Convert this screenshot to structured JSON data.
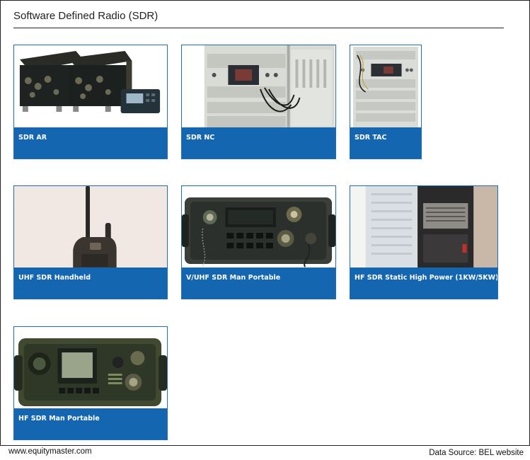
{
  "heading": "Software Defined Radio (SDR)",
  "products": [
    {
      "label": "SDR AR",
      "image": "sdr-ar-photo"
    },
    {
      "label": "SDR NC",
      "image": "sdr-nc-photo"
    },
    {
      "label": "SDR TAC",
      "image": "sdr-tac-photo"
    },
    {
      "label": "UHF SDR Handheld",
      "image": "uhf-handheld-photo"
    },
    {
      "label": "V/UHF SDR Man Portable",
      "image": "vuhf-man-portable-photo"
    },
    {
      "label": "HF SDR Static High Power (1KW/5KW)",
      "image": "hf-static-high-power-photo"
    },
    {
      "label": "HF SDR Man Portable",
      "image": "hf-man-portable-photo"
    }
  ],
  "footer": {
    "website": "www.equitymaster.com",
    "source": "Data Source: BEL website"
  },
  "colors": {
    "caption_blue": "#1566b0",
    "card_border": "#1e6fb5"
  }
}
